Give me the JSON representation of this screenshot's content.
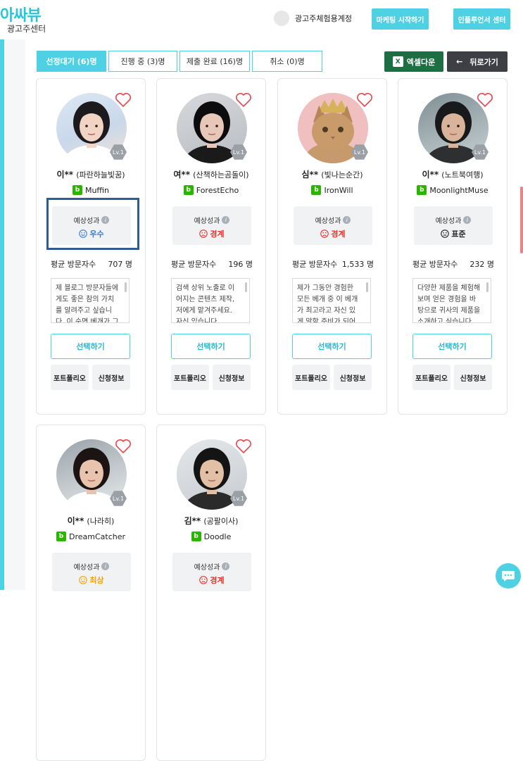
{
  "header": {
    "logo": "아싸뷰",
    "logo_sub": "광고주센터",
    "account_name": "광고주체험용계정",
    "marketing_button": "마케팅 시작하기",
    "influencer_button": "인플루언서 센터"
  },
  "tabs": [
    {
      "label": "선정대기 (6)명",
      "active": true
    },
    {
      "label": "진행 중 (3)명",
      "active": false
    },
    {
      "label": "제출 완료 (16)명",
      "active": false
    },
    {
      "label": "취소 (0)명",
      "active": false
    }
  ],
  "actions": {
    "excel_icon": "X",
    "excel_label": "엑셀다운",
    "back_arrow": "←",
    "back_label": "뒤로가기"
  },
  "card_labels": {
    "perf_label": "예상성과",
    "visits_label": "평균 방문자수",
    "select_button": "선택하기",
    "portfolio_button": "포트폴리오",
    "apply_info_button": "신청정보",
    "blog_badge": "b",
    "info_icon": "i"
  },
  "influencers": [
    {
      "name": "이**",
      "nick": "(파란하늘빛꿈)",
      "blog": "Muffin",
      "level": "Lv.1",
      "perf": "우수",
      "perf_color": "#3a7bd5",
      "visits": "707 명",
      "desc": "제 블로그 방문자들에게도 좋은 참의 가치를 알려주고 싶습니다. 이 순면 베개가 그 시작이"
    },
    {
      "name": "여**",
      "nick": "(산책하는곰돌이)",
      "blog": "ForestEcho",
      "level": "Lv.1",
      "perf": "경계",
      "perf_color": "#e0342c",
      "visits": "196 명",
      "desc": "검색 상위 노출로 이어지는 콘텐츠 제작, 저에게 맡겨주세요. 자신 있습니다"
    },
    {
      "name": "심**",
      "nick": "(빛나는순간)",
      "blog": "IronWill",
      "level": "Lv.1",
      "perf": "경계",
      "perf_color": "#e0342c",
      "visits": "1,533 명",
      "desc": "제가 그동안 경험한 모든 베개 중 이 베개가 최고라고 자신 있게 말할 준비가 되어 있습니"
    },
    {
      "name": "이**",
      "nick": "(노트북여행)",
      "blog": "MoonlightMuse",
      "level": "Lv.1",
      "perf": "표준",
      "perf_color": "#222222",
      "visits": "232 명",
      "desc": "다양한 제품을 체험해보며 얻은 경험을 바탕으로 귀사의 제품을 소개하고 싶습니다"
    },
    {
      "name": "이**",
      "nick": "(나라히)",
      "blog": "DreamCatcher",
      "level": "Lv.1",
      "perf": "최상",
      "perf_color": "#f0a500",
      "visits": "",
      "desc": ""
    },
    {
      "name": "김**",
      "nick": "(공팔이사)",
      "blog": "Doodle",
      "level": "Lv.1",
      "perf": "경계",
      "perf_color": "#e0342c",
      "visits": "",
      "desc": ""
    }
  ],
  "colors": {
    "accent": "#4fd1e4",
    "excel": "#1e6e43",
    "back": "#3d3f45",
    "heart": "#e8484f",
    "highlight": "#2f5d92"
  }
}
